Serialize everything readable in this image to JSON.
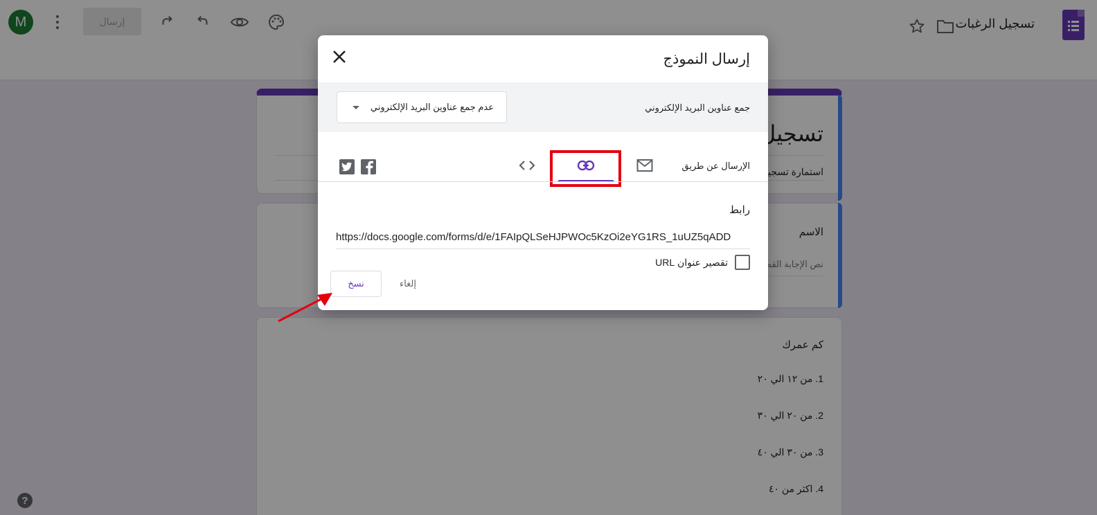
{
  "topbar": {
    "avatar_letter": "M",
    "send_label": "إرسال",
    "doc_title": "تسجيل الرغبات",
    "icons": [
      "more-vert-icon",
      "redo-icon",
      "undo-icon",
      "preview-eye-icon",
      "palette-icon",
      "star-icon",
      "folder-icon",
      "forms-logo-icon"
    ]
  },
  "form": {
    "title": "تسجيل",
    "description": "استمارة تسجيل",
    "question1": {
      "title": "الاسم",
      "placeholder": "نص الإجابة القصيرة"
    },
    "question2": {
      "title": "كم عمرك",
      "options": [
        "1.  من ١٢ الي ٢٠",
        "2.  من ٢٠ الي ٣٠",
        "3.  من ٣٠ الي ٤٠",
        "4.  اكثر من ٤٠"
      ]
    }
  },
  "dialog": {
    "title": "إرسال النموذج",
    "collect_emails_label": "جمع عناوين البريد الإلكتروني",
    "collect_emails_value": "عدم جمع عناوين البريد الإلكتروني",
    "send_via_label": "الإرسال عن طريق",
    "tabs": [
      "email-icon",
      "link-icon",
      "embed-code-icon"
    ],
    "selected_tab": "link",
    "social": [
      "facebook-icon",
      "twitter-icon"
    ],
    "link_label": "رابط",
    "link_url": "https://docs.google.com/forms/d/e/1FAIpQLSeHJPWOc5KzOi2eYG1RS_1uUZ5qADD",
    "shorten_label": "تقصير عنوان URL",
    "shorten_checked": false,
    "cancel_label": "إلغاء",
    "copy_label": "نسخ"
  },
  "help_label": "?",
  "colors": {
    "accent": "#673ab7",
    "highlight": "#e3000f",
    "avatar": "#1e7e34"
  }
}
